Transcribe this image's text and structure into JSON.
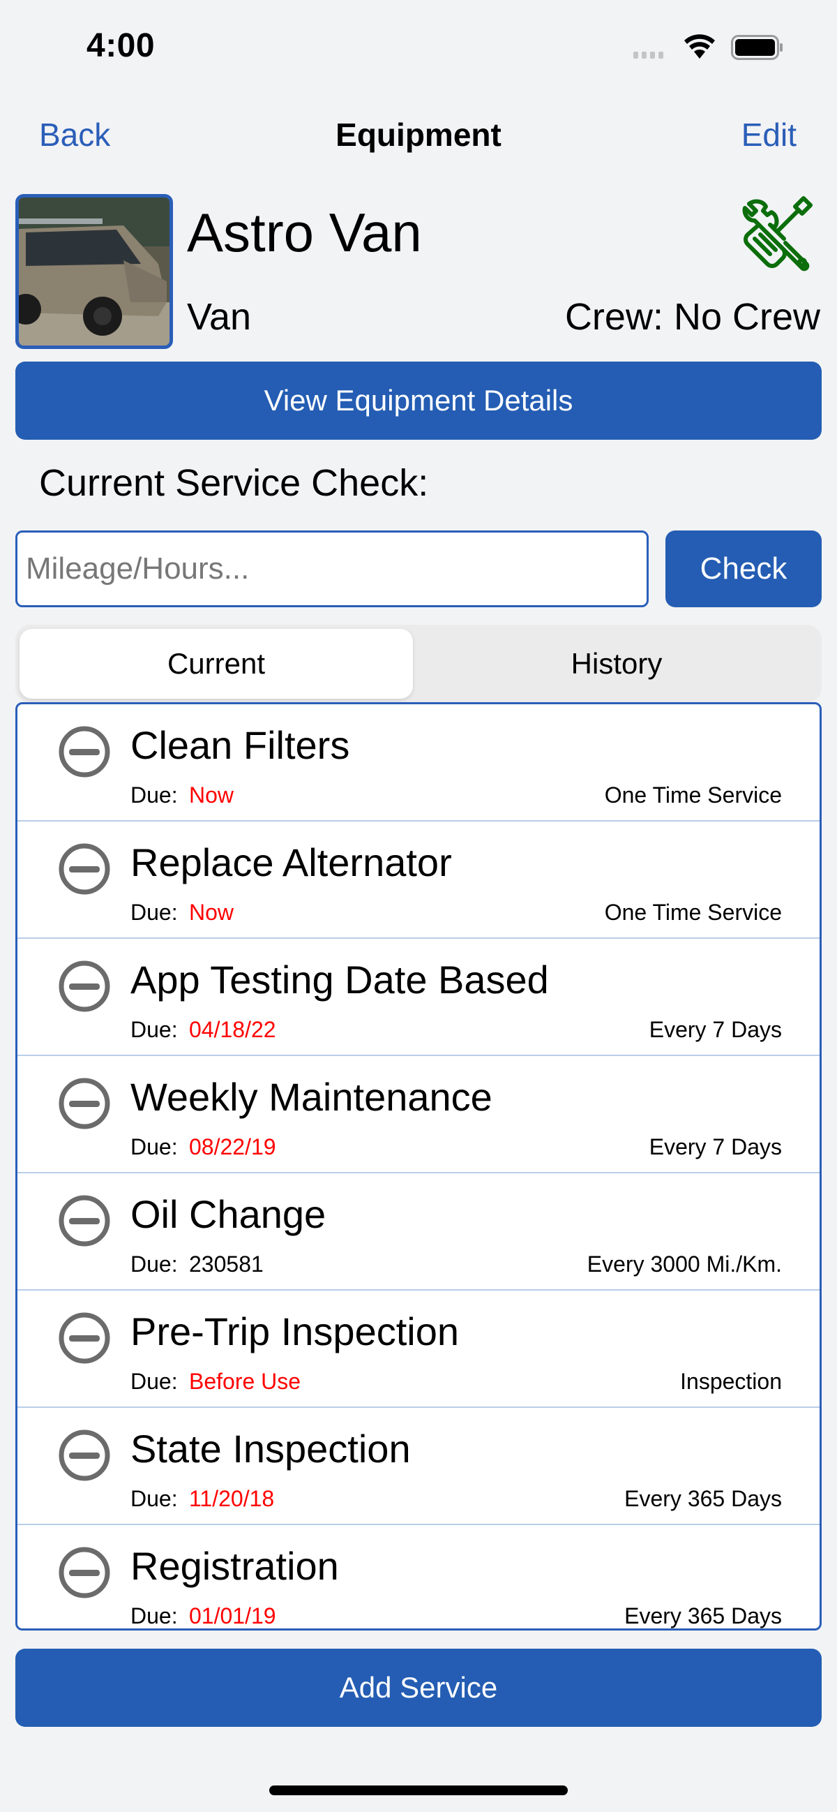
{
  "status_bar": {
    "time": "4:00",
    "icons": [
      "signal-icon",
      "wifi-icon",
      "battery-icon"
    ]
  },
  "nav": {
    "back_label": "Back",
    "title": "Equipment",
    "edit_label": "Edit"
  },
  "equipment": {
    "name": "Astro Van",
    "type": "Van",
    "crew": "Crew: No Crew",
    "photo_alt": "Astro Van photo",
    "service_icon": "wrench-screwdriver-icon"
  },
  "buttons": {
    "view_details": "View Equipment Details",
    "check": "Check",
    "add_service": "Add Service"
  },
  "service_check": {
    "label": "Current Service Check:",
    "placeholder": "Mileage/Hours...",
    "value": ""
  },
  "tabs": [
    {
      "label": "Current",
      "active": true
    },
    {
      "label": "History",
      "active": false
    }
  ],
  "colors": {
    "accent": "#245db3",
    "overdue": "#ff0000",
    "tools_icon": "#0b6e0b"
  },
  "services": [
    {
      "title": "Clean Filters",
      "due_label": "Due:",
      "due": "Now",
      "overdue": true,
      "frequency": "One Time Service"
    },
    {
      "title": "Replace Alternator",
      "due_label": "Due:",
      "due": "Now",
      "overdue": true,
      "frequency": "One Time Service"
    },
    {
      "title": "App Testing Date Based",
      "due_label": "Due:",
      "due": "04/18/22",
      "overdue": true,
      "frequency": "Every 7 Days"
    },
    {
      "title": "Weekly Maintenance",
      "due_label": "Due:",
      "due": "08/22/19",
      "overdue": true,
      "frequency": "Every 7 Days"
    },
    {
      "title": "Oil Change",
      "due_label": "Due:",
      "due": "230581",
      "overdue": false,
      "frequency": "Every 3000 Mi./Km."
    },
    {
      "title": "Pre-Trip Inspection",
      "due_label": "Due:",
      "due": "Before Use",
      "overdue": true,
      "frequency": "Inspection"
    },
    {
      "title": "State Inspection",
      "due_label": "Due:",
      "due": "11/20/18",
      "overdue": true,
      "frequency": "Every 365 Days"
    },
    {
      "title": "Registration",
      "due_label": "Due:",
      "due": "01/01/19",
      "overdue": true,
      "frequency": "Every 365 Days"
    }
  ]
}
